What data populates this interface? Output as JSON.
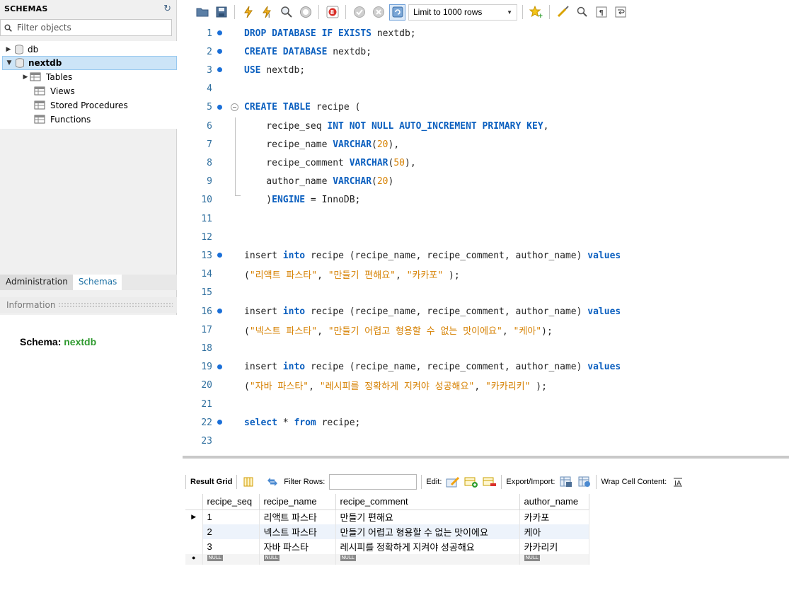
{
  "sidebar": {
    "title": "SCHEMAS",
    "filter_placeholder": "Filter objects",
    "tree": [
      {
        "label": "db"
      },
      {
        "label": "nextdb"
      },
      {
        "label": "Tables"
      },
      {
        "label": "Views"
      },
      {
        "label": "Stored Procedures"
      },
      {
        "label": "Functions"
      }
    ],
    "tabs": [
      "Administration",
      "Schemas"
    ],
    "info_title": "Information",
    "schema_label": "Schema:",
    "schema_name": "nextdb"
  },
  "toolbar": {
    "limit_label": "Limit to 1000 rows",
    "icons": [
      "folder-open-icon",
      "save-icon",
      "execute-icon",
      "execute-current-icon",
      "explain-icon",
      "stop-icon",
      "toggle-error-icon",
      "commit-icon",
      "rollback-icon",
      "autocommit-icon",
      "favorite-icon",
      "beautify-icon",
      "find-icon",
      "invisible-chars-icon",
      "wrap-icon"
    ]
  },
  "editor": {
    "lines": [
      {
        "n": "1",
        "dot": true,
        "tokens": [
          [
            "kw",
            "DROP DATABASE IF EXISTS "
          ],
          [
            "plain",
            "nextdb;"
          ]
        ]
      },
      {
        "n": "2",
        "dot": true,
        "tokens": [
          [
            "kw",
            "CREATE DATABASE "
          ],
          [
            "plain",
            "nextdb;"
          ]
        ]
      },
      {
        "n": "3",
        "dot": true,
        "tokens": [
          [
            "kw",
            "USE "
          ],
          [
            "plain",
            "nextdb;"
          ]
        ]
      },
      {
        "n": "4",
        "dot": false,
        "tokens": []
      },
      {
        "n": "5",
        "dot": true,
        "fold": true,
        "tokens": [
          [
            "kw",
            "CREATE TABLE "
          ],
          [
            "plain",
            "recipe ("
          ]
        ]
      },
      {
        "n": "6",
        "dot": false,
        "tokens": [
          [
            "plain",
            "    recipe_seq "
          ],
          [
            "kw",
            "INT NOT NULL AUTO_INCREMENT PRIMARY KEY"
          ],
          [
            "plain",
            ","
          ]
        ]
      },
      {
        "n": "7",
        "dot": false,
        "tokens": [
          [
            "plain",
            "    recipe_name "
          ],
          [
            "kw",
            "VARCHAR"
          ],
          [
            "plain",
            "("
          ],
          [
            "num",
            "20"
          ],
          [
            "plain",
            "),"
          ]
        ]
      },
      {
        "n": "8",
        "dot": false,
        "tokens": [
          [
            "plain",
            "    recipe_comment "
          ],
          [
            "kw",
            "VARCHAR"
          ],
          [
            "plain",
            "("
          ],
          [
            "num",
            "50"
          ],
          [
            "plain",
            "),"
          ]
        ]
      },
      {
        "n": "9",
        "dot": false,
        "tokens": [
          [
            "plain",
            "    author_name "
          ],
          [
            "kw",
            "VARCHAR"
          ],
          [
            "plain",
            "("
          ],
          [
            "num",
            "20"
          ],
          [
            "plain",
            ")"
          ]
        ]
      },
      {
        "n": "10",
        "dot": false,
        "tokens": [
          [
            "plain",
            "    )"
          ],
          [
            "kw",
            "ENGINE"
          ],
          [
            "plain",
            " = InnoDB;"
          ]
        ]
      },
      {
        "n": "11",
        "dot": false,
        "tokens": []
      },
      {
        "n": "12",
        "dot": false,
        "tokens": []
      },
      {
        "n": "13",
        "dot": true,
        "tokens": [
          [
            "plain",
            "insert "
          ],
          [
            "kw",
            "into "
          ],
          [
            "plain",
            "recipe (recipe_name, recipe_comment, author_name) "
          ],
          [
            "kw",
            "values"
          ]
        ]
      },
      {
        "n": "14",
        "dot": false,
        "tokens": [
          [
            "plain",
            "("
          ],
          [
            "str",
            "\"리액트 파스타\""
          ],
          [
            "plain",
            ", "
          ],
          [
            "str",
            "\"만들기 편해요\""
          ],
          [
            "plain",
            ", "
          ],
          [
            "str",
            "\"카카포\""
          ],
          [
            "plain",
            " );"
          ]
        ]
      },
      {
        "n": "15",
        "dot": false,
        "tokens": []
      },
      {
        "n": "16",
        "dot": true,
        "tokens": [
          [
            "plain",
            "insert "
          ],
          [
            "kw",
            "into "
          ],
          [
            "plain",
            "recipe (recipe_name, recipe_comment, author_name) "
          ],
          [
            "kw",
            "values"
          ]
        ]
      },
      {
        "n": "17",
        "dot": false,
        "tokens": [
          [
            "plain",
            "("
          ],
          [
            "str",
            "\"넥스트 파스타\""
          ],
          [
            "plain",
            ", "
          ],
          [
            "str",
            "\"만들기 어렵고 형용할 수 없는 맛이에요\""
          ],
          [
            "plain",
            ", "
          ],
          [
            "str",
            "\"케아\""
          ],
          [
            "plain",
            ");"
          ]
        ]
      },
      {
        "n": "18",
        "dot": false,
        "tokens": []
      },
      {
        "n": "19",
        "dot": true,
        "tokens": [
          [
            "plain",
            "insert "
          ],
          [
            "kw",
            "into "
          ],
          [
            "plain",
            "recipe (recipe_name, recipe_comment, author_name) "
          ],
          [
            "kw",
            "values"
          ]
        ]
      },
      {
        "n": "20",
        "dot": false,
        "tokens": [
          [
            "plain",
            "("
          ],
          [
            "str",
            "\"자바 파스타\""
          ],
          [
            "plain",
            ", "
          ],
          [
            "str",
            "\"레시피를 정확하게 지켜야 성공해요\""
          ],
          [
            "plain",
            ", "
          ],
          [
            "str",
            "\"카카리키\""
          ],
          [
            "plain",
            " );"
          ]
        ]
      },
      {
        "n": "21",
        "dot": false,
        "tokens": []
      },
      {
        "n": "22",
        "dot": true,
        "tokens": [
          [
            "kw",
            "select "
          ],
          [
            "plain",
            "* "
          ],
          [
            "kw",
            "from "
          ],
          [
            "plain",
            "recipe;"
          ]
        ]
      },
      {
        "n": "23",
        "dot": false,
        "tokens": []
      }
    ]
  },
  "result": {
    "result_grid_label": "Result Grid",
    "filter_rows_label": "Filter Rows:",
    "edit_label": "Edit:",
    "export_label": "Export/Import:",
    "wrap_label": "Wrap Cell Content:",
    "columns": [
      "recipe_seq",
      "recipe_name",
      "recipe_comment",
      "author_name"
    ],
    "rows": [
      [
        "1",
        "리액트 파스타",
        "만들기 편해요",
        "카카포"
      ],
      [
        "2",
        "넥스트 파스타",
        "만들기 어렵고 형용할 수 없는 맛이에요",
        "케아"
      ],
      [
        "3",
        "자바 파스타",
        "레시피를 정확하게 지켜야 성공해요",
        "카카리키"
      ]
    ],
    "null_label": "NULL"
  }
}
